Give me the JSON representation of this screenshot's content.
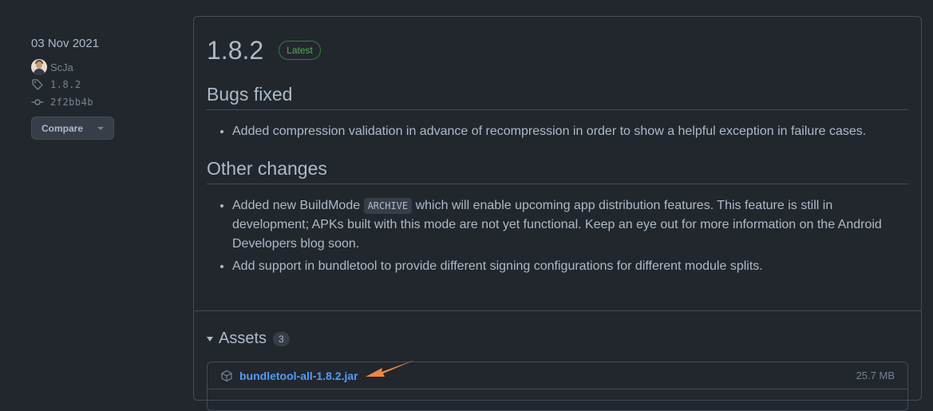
{
  "sidebar": {
    "date": "03 Nov 2021",
    "author": "ScJa",
    "tag": "1.8.2",
    "commit": "2f2bb4b",
    "compare_label": "Compare"
  },
  "release": {
    "version": "1.8.2",
    "badge": "Latest",
    "sections": {
      "bugs": {
        "heading": "Bugs fixed",
        "items": [
          "Added compression validation in advance of recompression in order to show a helpful exception in failure cases."
        ]
      },
      "other": {
        "heading": "Other changes",
        "item1_before": "Added new BuildMode ",
        "item1_code": "ARCHIVE",
        "item1_line1_after": " which will enable upcoming app distribution features. This feature is still in",
        "item1_line2": "development; APKs built with this mode are not yet functional. Keep an eye out for more information on the Android",
        "item1_line3": "Developers blog soon.",
        "item2": "Add support in bundletool to provide different signing configurations for different module splits."
      }
    }
  },
  "assets": {
    "title": "Assets",
    "count": "3",
    "items": [
      {
        "name": "bundletool-all-1.8.2.jar",
        "size": "25.7 MB"
      }
    ]
  },
  "colors": {
    "background": "#22272e",
    "link": "#539bf5",
    "latest_badge": "#57ab5a",
    "annotation_arrow": "#f0883e"
  }
}
